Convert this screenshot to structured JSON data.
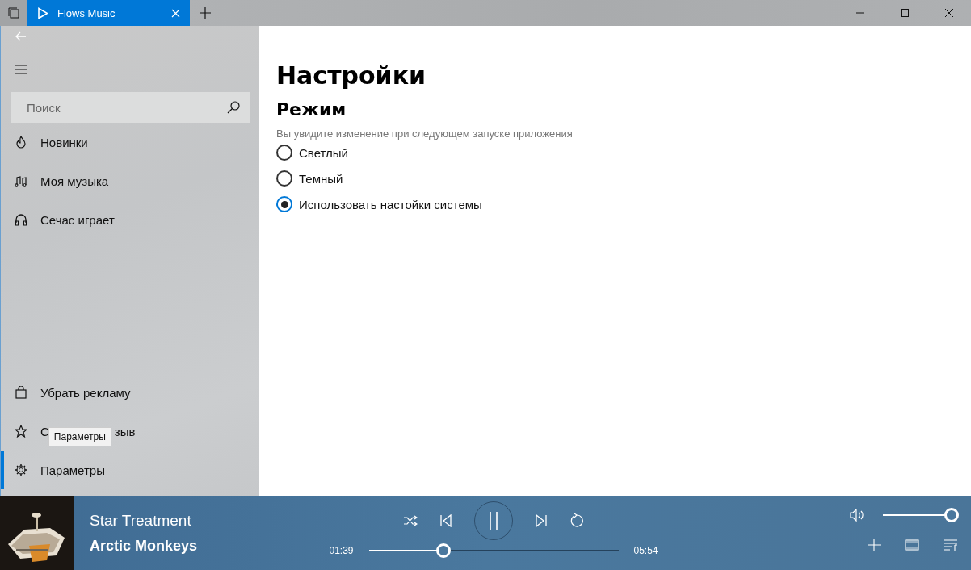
{
  "tab_bar": {
    "tab": {
      "title": "Flows Music",
      "selected": true
    }
  },
  "sidebar": {
    "search": {
      "placeholder": "Поиск"
    },
    "top_items": [
      {
        "label": "Новинки",
        "selected": false
      },
      {
        "label": "Моя музыка",
        "selected": false
      },
      {
        "label": "Сечас играет",
        "selected": false
      }
    ],
    "bottom_items": [
      {
        "label": "Убрать рекламу",
        "selected": false
      },
      {
        "label_start": "С",
        "label_end": "зыв",
        "selected": false,
        "tooltip": "Параметры"
      },
      {
        "label": "Параметры",
        "selected": true
      }
    ]
  },
  "content": {
    "title": "Настройки",
    "section": "Режим",
    "hint": "Вы увидите изменение при следующем запуске приложения",
    "options": [
      {
        "label": "Светлый",
        "selected": false
      },
      {
        "label": "Темный",
        "selected": false
      },
      {
        "label": "Использовать настойки системы",
        "selected": true
      }
    ]
  },
  "player": {
    "track": "Star Treatment",
    "artist": "Arctic Monkeys",
    "elapsed": "01:39",
    "duration": "05:54",
    "progress": {
      "level": 0.3
    },
    "volume": {
      "level": 1.0
    }
  }
}
